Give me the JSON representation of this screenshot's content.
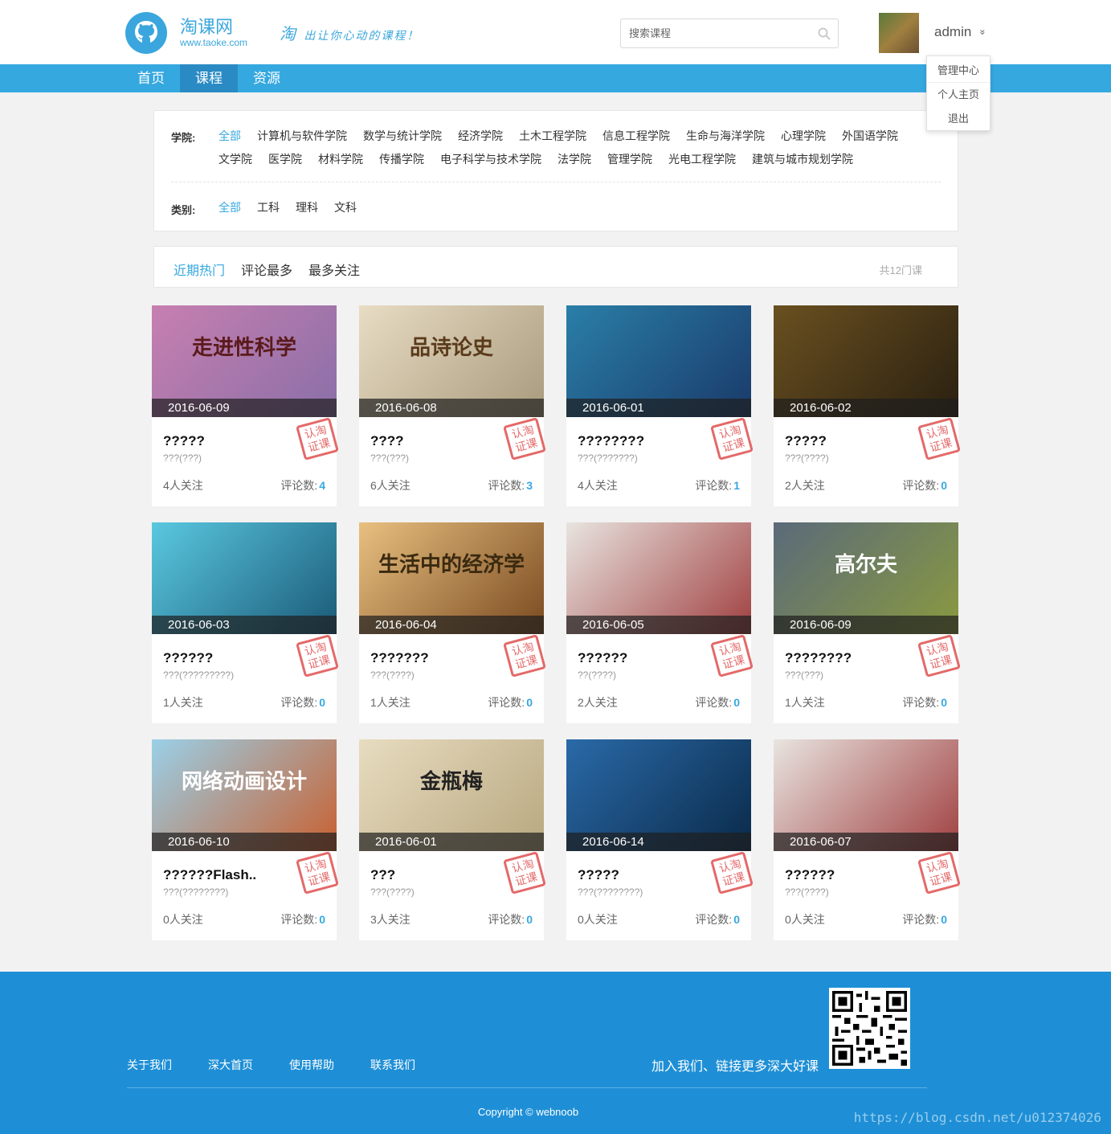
{
  "header": {
    "logo_title": "淘课网",
    "logo_url": "www.taoke.com",
    "slogan_main": "淘",
    "slogan_rest": "出让你心动的课程！",
    "search_placeholder": "搜索课程",
    "username": "admin",
    "chevron": "»"
  },
  "nav": {
    "items": [
      {
        "label": "首页"
      },
      {
        "label": "课程"
      },
      {
        "label": "资源"
      }
    ],
    "active": "课程"
  },
  "user_menu": {
    "items": [
      {
        "label": "管理中心"
      },
      {
        "label": "个人主页"
      },
      {
        "label": "退出"
      }
    ]
  },
  "filter": {
    "college_label": "学院:",
    "colleges": [
      "全部",
      "计算机与软件学院",
      "数学与统计学院",
      "经济学院",
      "土木工程学院",
      "信息工程学院",
      "生命与海洋学院",
      "心理学院",
      "外国语学院",
      "文学院",
      "医学院",
      "材料学院",
      "传播学院",
      "电子科学与技术学院",
      "法学院",
      "管理学院",
      "光电工程学院",
      "建筑与城市规划学院"
    ],
    "category_label": "类别:",
    "categories": [
      "全部",
      "工科",
      "理科",
      "文科"
    ]
  },
  "sortbar": {
    "options": [
      "近期热门",
      "评论最多",
      "最多关注"
    ],
    "count_text": "共12门课"
  },
  "courses": [
    {
      "date": "2016-06-09",
      "title": "?????",
      "sub": "???(???)",
      "follow": "4人关注",
      "comment_label": "评论数:",
      "comments": "4",
      "art_text": "走进性科学",
      "colors": [
        "#c77fb0",
        "#8a6fa8"
      ],
      "text_color": "#5a1a1a"
    },
    {
      "date": "2016-06-08",
      "title": "????",
      "sub": "???(???)",
      "follow": "6人关注",
      "comment_label": "评论数:",
      "comments": "3",
      "art_text": "品诗论史",
      "colors": [
        "#e8dcc4",
        "#a89a7c"
      ],
      "text_color": "#5a3a1a"
    },
    {
      "date": "2016-06-01",
      "title": "????????",
      "sub": "???(???????)",
      "follow": "4人关注",
      "comment_label": "评论数:",
      "comments": "1",
      "art_text": "",
      "colors": [
        "#2a7fa8",
        "#1a3a6a"
      ],
      "text_color": "#fff"
    },
    {
      "date": "2016-06-02",
      "title": "?????",
      "sub": "???(????)",
      "follow": "2人关注",
      "comment_label": "评论数:",
      "comments": "0",
      "art_text": "",
      "colors": [
        "#6a5020",
        "#2a2010"
      ],
      "text_color": "#fff"
    },
    {
      "date": "2016-06-03",
      "title": "??????",
      "sub": "???(?????????)",
      "follow": "1人关注",
      "comment_label": "评论数:",
      "comments": "0",
      "art_text": "",
      "colors": [
        "#5ac8e0",
        "#1a5a78"
      ],
      "text_color": "#fff"
    },
    {
      "date": "2016-06-04",
      "title": "???????",
      "sub": "???(????)",
      "follow": "1人关注",
      "comment_label": "评论数:",
      "comments": "0",
      "art_text": "生活中的经济学",
      "colors": [
        "#e8c080",
        "#7a4a20"
      ],
      "text_color": "#3a2a10"
    },
    {
      "date": "2016-06-05",
      "title": "??????",
      "sub": "??(????)",
      "follow": "2人关注",
      "comment_label": "评论数:",
      "comments": "0",
      "art_text": "",
      "colors": [
        "#e8e4e0",
        "#a04040"
      ],
      "text_color": "#333"
    },
    {
      "date": "2016-06-09",
      "title": "????????",
      "sub": "???(???)",
      "follow": "1人关注",
      "comment_label": "评论数:",
      "comments": "0",
      "art_text": "高尔夫",
      "colors": [
        "#5a6a7a",
        "#8a9a40"
      ],
      "text_color": "#fff"
    },
    {
      "date": "2016-06-10",
      "title": "??????Flash..",
      "sub": "???(????????)",
      "follow": "0人关注",
      "comment_label": "评论数:",
      "comments": "0",
      "art_text": "网络动画设计",
      "colors": [
        "#9ad0e8",
        "#c86030"
      ],
      "text_color": "#fff"
    },
    {
      "date": "2016-06-01",
      "title": "???",
      "sub": "???(????)",
      "follow": "3人关注",
      "comment_label": "评论数:",
      "comments": "0",
      "art_text": "金瓶梅",
      "colors": [
        "#e8dcc0",
        "#b8a880"
      ],
      "text_color": "#222"
    },
    {
      "date": "2016-06-14",
      "title": "?????",
      "sub": "???(????????)",
      "follow": "0人关注",
      "comment_label": "评论数:",
      "comments": "0",
      "art_text": "",
      "colors": [
        "#2a6aa8",
        "#0a2a4a"
      ],
      "text_color": "#fff"
    },
    {
      "date": "2016-06-07",
      "title": "??????",
      "sub": "???(????)",
      "follow": "0人关注",
      "comment_label": "评论数:",
      "comments": "0",
      "art_text": "",
      "colors": [
        "#e8e4e0",
        "#a04040"
      ],
      "text_color": "#333"
    }
  ],
  "stamp_text": "认淘证课",
  "footer": {
    "links": [
      "关于我们",
      "深大首页",
      "使用帮助",
      "联系我们"
    ],
    "join_text": "加入我们、链接更多深大好课",
    "copyright": "Copyright © webnoob",
    "watermark": "https://blog.csdn.net/u012374026"
  },
  "colors": {
    "accent": "#36a8e0",
    "nav_active": "#2a8bc4",
    "footer_bg": "#1e8fd6",
    "stamp": "#e05050"
  }
}
